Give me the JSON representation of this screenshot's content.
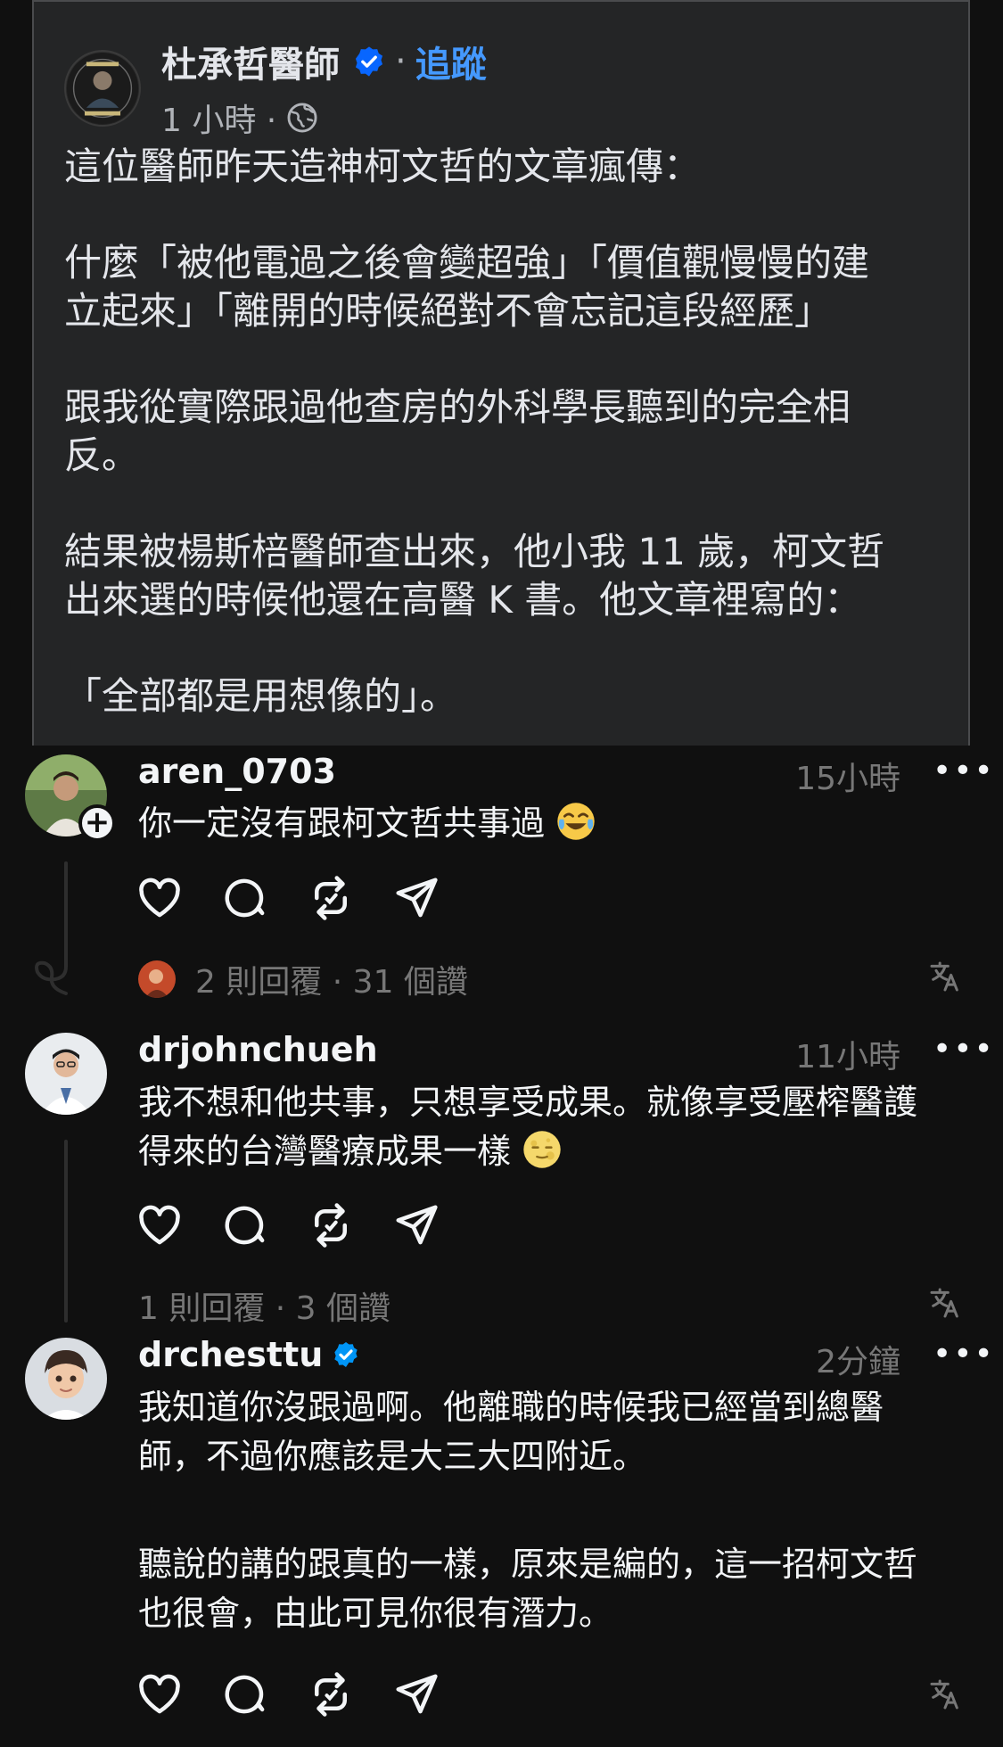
{
  "facebook_post": {
    "author": "杜承哲醫師",
    "separator": "·",
    "follow_label": "追蹤",
    "time": "1 小時 ·",
    "paragraphs": [
      [
        "這位醫師昨天造神柯文哲的文章瘋傳："
      ],
      [
        "什麼「被他電過之後會變超強」「價值觀慢慢的建",
        "立起來」「離開的時候絕對不會忘記這段經歷」"
      ],
      [
        "跟我從實際跟過他查房的外科學長聽到的完全相",
        "反。"
      ],
      [
        "結果被楊斯棓醫師查出來，他小我 11 歲，柯文哲",
        "出來選的時候他還在高醫 K 書。他文章裡寫的："
      ],
      [
        "「全部都是用想像的」。"
      ]
    ]
  },
  "comments": [
    {
      "username": "aren_0703",
      "time": "15小時",
      "more": "•••",
      "lines": [
        "你一定沒有跟柯文哲共事過"
      ],
      "stats": "2 則回覆 · 31 個讚",
      "follow_plus": "+"
    },
    {
      "username": "drjohnchueh",
      "time": "11小時",
      "more": "•••",
      "lines": [
        "我不想和他共事，只想享受成果。就像享受壓榨醫護",
        "得來的台灣醫療成果一樣"
      ],
      "stats": "1 則回覆 · 3 個讚"
    },
    {
      "username": "drchesttu",
      "time": "2分鐘",
      "more": "•••",
      "paragraphs": [
        [
          "我知道你沒跟過啊。他離職的時候我已經當到總醫",
          "師，不過你應該是大三大四附近。"
        ],
        [
          "聽說的講的跟真的一樣，原來是編的，這一招柯文哲",
          "也很會，由此可見你很有潛力。"
        ]
      ]
    }
  ],
  "icons": {
    "like": "heart-icon",
    "reply": "comment-icon",
    "repost": "repost-icon",
    "share": "share-icon",
    "translate": "translate-icon",
    "verified": "verified-badge-icon"
  },
  "colors": {
    "background": "#101010",
    "fb_card": "#242526",
    "link_blue": "#4599ff",
    "muted": "#777777",
    "verified_blue": "#0095f6"
  }
}
